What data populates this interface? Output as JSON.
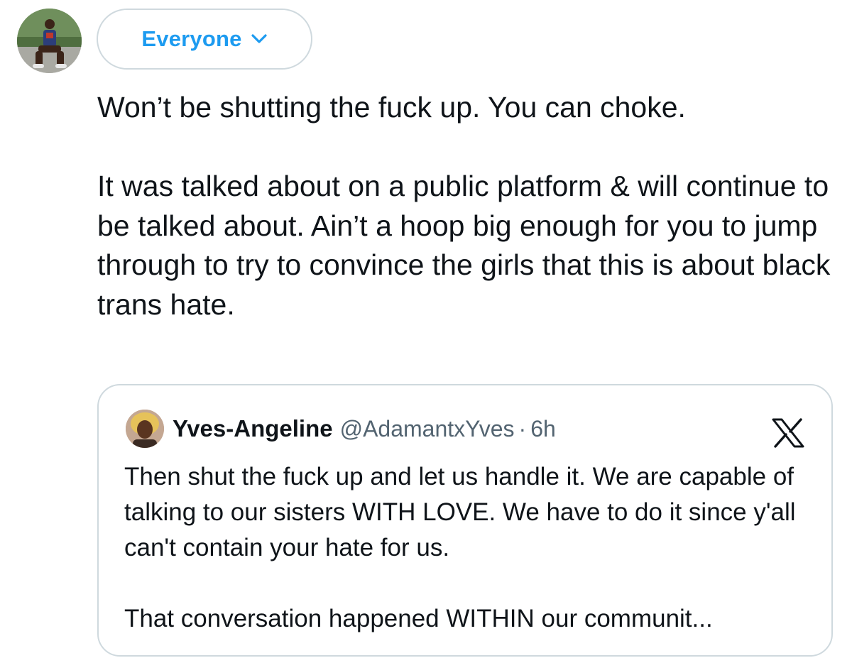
{
  "composer": {
    "audience_label": "Everyone",
    "audience_icon": "chevron-down-icon",
    "avatar_icon": "user-avatar"
  },
  "tweet": {
    "paragraphs": [
      "Won’t be shutting the fuck up. You can choke.",
      "It was talked about on a public platform & will continue to be talked about. Ain’t a hoop big enough for you to jump through to try to convince the girls that this is about black trans hate."
    ]
  },
  "quoted": {
    "name": "Yves-Angeline",
    "handle": "@AdamantxYves",
    "separator": "·",
    "time": "6h",
    "logo_icon": "x-logo-icon",
    "paragraphs": [
      "Then shut the fuck up and let us handle it. We are capable of talking to our sisters WITH LOVE. We have to do it since y'all can't contain your hate for us.",
      "That conversation happened WITHIN our communit..."
    ]
  },
  "colors": {
    "accent": "#1d9bf0",
    "text": "#0f1419",
    "muted": "#536471",
    "border": "#cfd9de"
  }
}
